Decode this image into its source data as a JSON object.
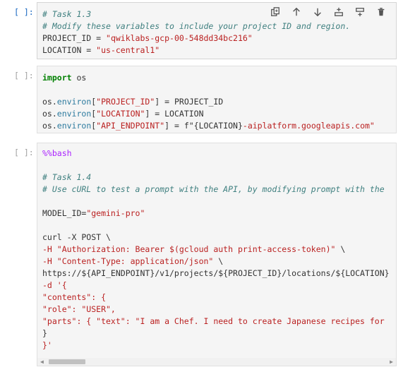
{
  "cells": [
    {
      "prompt": "[ ]:",
      "lines": [
        [
          {
            "t": "# Task 1.3",
            "c": "c-comment"
          }
        ],
        [
          {
            "t": "# Modify these variables to include your project ID and region.",
            "c": "c-comment"
          }
        ],
        [
          {
            "t": "PROJECT_ID = ",
            "c": "c-op"
          },
          {
            "t": "\"qwiklabs-gcp-00-548dd34bc216\"",
            "c": "c-str"
          }
        ],
        [
          {
            "t": "LOCATION = ",
            "c": "c-op"
          },
          {
            "t": "\"us-central1\"",
            "c": "c-str"
          }
        ]
      ]
    },
    {
      "prompt": "[ ]:",
      "lines": [
        [
          {
            "t": "import",
            "c": "c-kw"
          },
          {
            "t": " os",
            "c": "c-op"
          }
        ],
        [
          {
            "t": "",
            "c": "c-op"
          }
        ],
        [
          {
            "t": "os.",
            "c": "c-op"
          },
          {
            "t": "environ",
            "c": "c-attr"
          },
          {
            "t": "[",
            "c": "c-op"
          },
          {
            "t": "\"PROJECT_ID\"",
            "c": "c-str"
          },
          {
            "t": "] = PROJECT_ID",
            "c": "c-op"
          }
        ],
        [
          {
            "t": "os.",
            "c": "c-op"
          },
          {
            "t": "environ",
            "c": "c-attr"
          },
          {
            "t": "[",
            "c": "c-op"
          },
          {
            "t": "\"LOCATION\"",
            "c": "c-str"
          },
          {
            "t": "] = LOCATION",
            "c": "c-op"
          }
        ],
        [
          {
            "t": "os.",
            "c": "c-op"
          },
          {
            "t": "environ",
            "c": "c-attr"
          },
          {
            "t": "[",
            "c": "c-op"
          },
          {
            "t": "\"API_ENDPOINT\"",
            "c": "c-str"
          },
          {
            "t": "] = f\"{LOCATION}",
            "c": "c-op"
          },
          {
            "t": "-aiplatform.googleapis.com\"",
            "c": "c-str"
          }
        ]
      ]
    },
    {
      "prompt": "[ ]:",
      "lines": [
        [
          {
            "t": "%%bash",
            "c": "c-mag"
          }
        ],
        [
          {
            "t": "",
            "c": "c-op"
          }
        ],
        [
          {
            "t": "# Task 1.4",
            "c": "c-comment"
          }
        ],
        [
          {
            "t": "# Use cURL to test a prompt with the API, by modifying prompt with the",
            "c": "c-comment"
          }
        ],
        [
          {
            "t": "",
            "c": "c-op"
          }
        ],
        [
          {
            "t": "MODEL_ID=",
            "c": "c-op"
          },
          {
            "t": "\"gemini-pro\"",
            "c": "c-str"
          }
        ],
        [
          {
            "t": "",
            "c": "c-op"
          }
        ],
        [
          {
            "t": "curl -X POST \\",
            "c": "c-op"
          }
        ],
        [
          {
            "t": "-H ",
            "c": "c-str"
          },
          {
            "t": "\"Authorization: Bearer $(gcloud auth print-access-token)\"",
            "c": "c-str"
          },
          {
            "t": " \\",
            "c": "c-op"
          }
        ],
        [
          {
            "t": "-H ",
            "c": "c-str"
          },
          {
            "t": "\"Content-Type: application/json\"",
            "c": "c-str"
          },
          {
            "t": " \\",
            "c": "c-op"
          }
        ],
        [
          {
            "t": "https://${API_ENDPOINT}/v1/projects/${PROJECT_ID}/locations/${LOCATION}",
            "c": "c-op"
          }
        ],
        [
          {
            "t": "-d '{",
            "c": "c-str"
          }
        ],
        [
          {
            "t": "\"contents\": {",
            "c": "c-str"
          }
        ],
        [
          {
            "t": "\"role\": \"USER\",",
            "c": "c-str"
          }
        ],
        [
          {
            "t": "\"parts\": { \"text\": \"I am a Chef. I need to create Japanese recipes for",
            "c": "c-str"
          }
        ],
        [
          {
            "t": "}",
            "c": "c-op"
          }
        ],
        [
          {
            "t": "}'",
            "c": "c-str"
          }
        ]
      ]
    }
  ],
  "toolbar": {
    "icons": [
      "duplicate-cell-icon",
      "move-up-icon",
      "move-down-icon",
      "insert-above-icon",
      "insert-below-icon",
      "delete-cell-icon"
    ]
  }
}
